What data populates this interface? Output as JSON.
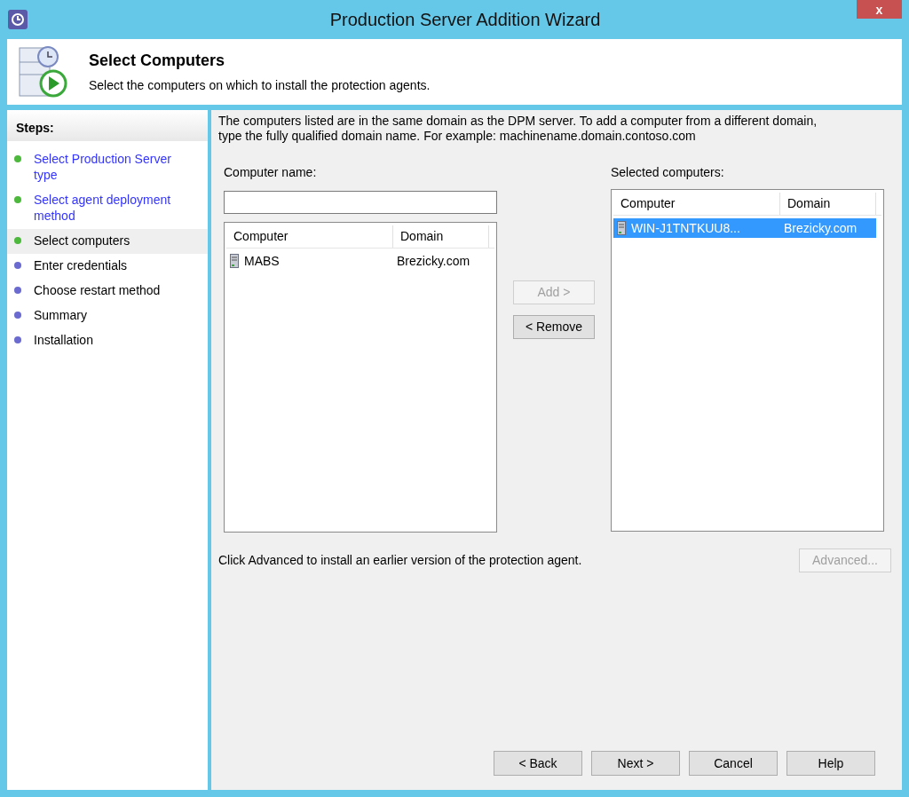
{
  "window": {
    "title": "Production Server Addition Wizard",
    "close": "x"
  },
  "header": {
    "title": "Select Computers",
    "subtitle": "Select the computers on which to install the protection agents."
  },
  "steps": {
    "heading": "Steps:",
    "items": [
      {
        "label": "Select Production Server type",
        "kind": "link",
        "color": "#4cb83c",
        "selected": false
      },
      {
        "label": "Select agent deployment method",
        "kind": "link",
        "color": "#4cb83c",
        "selected": false
      },
      {
        "label": "Select computers",
        "kind": "text",
        "color": "#4cb83c",
        "selected": true
      },
      {
        "label": "Enter credentials",
        "kind": "text",
        "color": "#6a6ad0",
        "selected": false
      },
      {
        "label": "Choose restart method",
        "kind": "text",
        "color": "#6a6ad0",
        "selected": false
      },
      {
        "label": "Summary",
        "kind": "text",
        "color": "#6a6ad0",
        "selected": false
      },
      {
        "label": "Installation",
        "kind": "text",
        "color": "#6a6ad0",
        "selected": false
      }
    ]
  },
  "intro": "The computers listed are in the same domain as the DPM server. To add a computer from a different domain, type the fully qualified domain name. For example: machinename.domain.contoso.com",
  "computer_name": {
    "label": "Computer name:"
  },
  "available": {
    "columns": [
      "Computer",
      "Domain"
    ],
    "rows": [
      {
        "computer": "MABS",
        "domain": "Brezicky.com",
        "selected": false
      }
    ]
  },
  "selected_computers": {
    "label": "Selected computers:",
    "columns": [
      "Computer",
      "Domain"
    ],
    "rows": [
      {
        "computer": "WIN-J1TNTKUU8...",
        "domain": "Brezicky.com",
        "selected": true
      }
    ]
  },
  "move_buttons": [
    {
      "label": "Add >",
      "disabled": true
    },
    {
      "label": "< Remove",
      "disabled": false
    }
  ],
  "advanced": {
    "text": "Click Advanced to install an earlier version of the protection agent.",
    "button": {
      "label": "Advanced...",
      "disabled": true
    }
  },
  "footer_buttons": [
    {
      "label": "< Back",
      "disabled": false
    },
    {
      "label": "Next >",
      "disabled": false
    },
    {
      "label": "Cancel",
      "disabled": false
    },
    {
      "label": "Help",
      "disabled": false
    }
  ]
}
